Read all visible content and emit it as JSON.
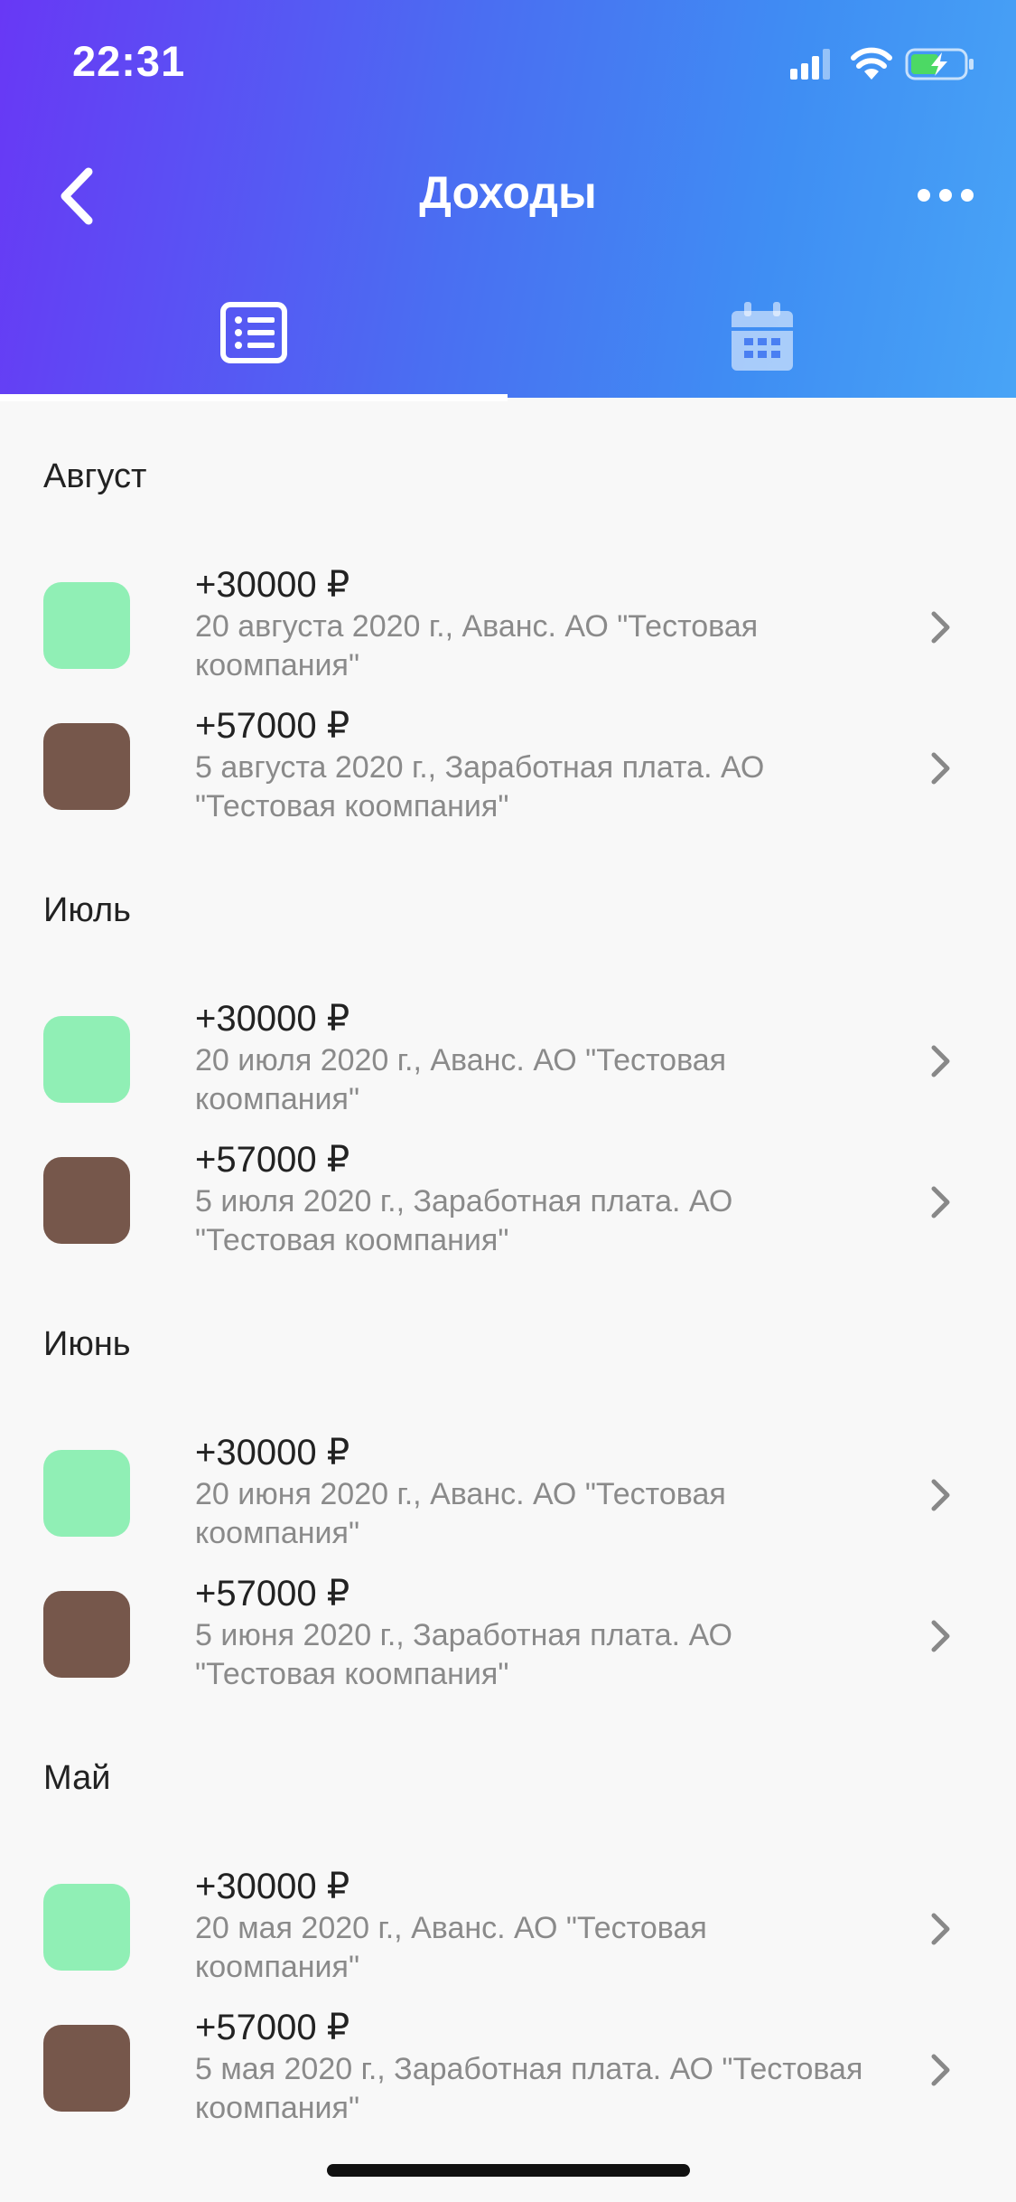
{
  "status": {
    "time": "22:31"
  },
  "header": {
    "title": "Доходы"
  },
  "tabs": [
    {
      "name": "list",
      "icon": "list-icon",
      "active": true
    },
    {
      "name": "calendar",
      "icon": "calendar-icon",
      "active": false
    }
  ],
  "colors": {
    "green": "#90efb5",
    "brown": "#76574b",
    "accent_start": "#6838f5",
    "accent_end": "#48a4f6"
  },
  "sections": [
    {
      "title": "Август",
      "items": [
        {
          "amount": "+30000 ₽",
          "desc": "20 августа 2020 г., Аванс. АО \"Тестовая коомпания\"",
          "color": "#90efb5"
        },
        {
          "amount": "+57000 ₽",
          "desc": "5 августа 2020 г., Заработная плата. АО \"Тестовая коомпания\"",
          "color": "#76574b"
        }
      ]
    },
    {
      "title": "Июль",
      "items": [
        {
          "amount": "+30000 ₽",
          "desc": "20 июля 2020 г., Аванс. АО \"Тестовая коомпания\"",
          "color": "#90efb5"
        },
        {
          "amount": "+57000 ₽",
          "desc": "5 июля 2020 г., Заработная плата. АО \"Тестовая коомпания\"",
          "color": "#76574b"
        }
      ]
    },
    {
      "title": "Июнь",
      "items": [
        {
          "amount": "+30000 ₽",
          "desc": "20 июня 2020 г., Аванс. АО \"Тестовая коомпания\"",
          "color": "#90efb5"
        },
        {
          "amount": "+57000 ₽",
          "desc": "5 июня 2020 г., Заработная плата. АО \"Тестовая коомпания\"",
          "color": "#76574b"
        }
      ]
    },
    {
      "title": "Май",
      "items": [
        {
          "amount": "+30000 ₽",
          "desc": "20 мая 2020 г., Аванс. АО \"Тестовая коомпания\"",
          "color": "#90efb5"
        },
        {
          "amount": "+57000 ₽",
          "desc": "5 мая 2020 г., Заработная плата. АО \"Тестовая коомпания\"",
          "color": "#76574b"
        }
      ]
    }
  ]
}
